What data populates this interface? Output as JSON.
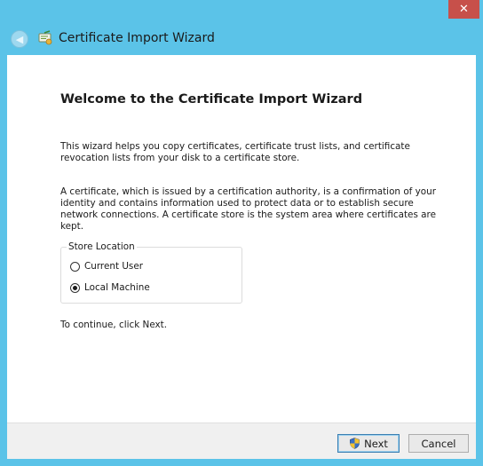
{
  "window": {
    "title": "Certificate Import Wizard",
    "close_glyph": "✕",
    "back_glyph": "◀",
    "app_icon": "certificate-icon"
  },
  "main": {
    "heading": "Welcome to the Certificate Import Wizard",
    "intro": "This wizard helps you copy certificates, certificate trust lists, and certificate revocation lists from your disk to a certificate store.",
    "description": "A certificate, which is issued by a certification authority, is a confirmation of your identity and contains information used to protect data or to establish secure network connections. A certificate store is the system area where certificates are kept.",
    "store_location": {
      "label": "Store Location",
      "options": [
        {
          "label": "Current User",
          "selected": false
        },
        {
          "label": "Local Machine",
          "selected": true
        }
      ]
    },
    "continue_text": "To continue, click Next."
  },
  "footer": {
    "next_label": "Next",
    "cancel_label": "Cancel"
  },
  "colors": {
    "frame": "#5bc3e8",
    "close": "#c7504a",
    "footer": "#f0f0f0"
  }
}
